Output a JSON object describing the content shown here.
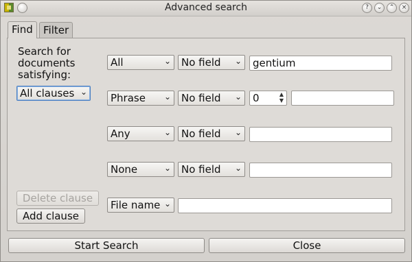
{
  "window": {
    "title": "Advanced search",
    "title_buttons": [
      "?",
      "⌄",
      "⌃",
      "×"
    ]
  },
  "tabs": [
    {
      "label": "Find",
      "active": true
    },
    {
      "label": "Filter",
      "active": false
    }
  ],
  "find": {
    "description": [
      "Search for",
      "documents",
      "satisfying:"
    ],
    "conjunction_select": "All clauses",
    "clauses": [
      {
        "type": "All",
        "field": "No field",
        "value": "gentium"
      },
      {
        "type": "Phrase",
        "field": "No field",
        "proximity": "0",
        "value": ""
      },
      {
        "type": "Any",
        "field": "No field",
        "value": ""
      },
      {
        "type": "None",
        "field": "No field",
        "value": ""
      },
      {
        "type": "File name",
        "value": ""
      }
    ],
    "delete_clause_label": "Delete clause",
    "add_clause_label": "Add clause"
  },
  "footer": {
    "start_search_label": "Start Search",
    "close_label": "Close"
  },
  "icons": {
    "dropdown": "chevron-down-icon",
    "spin_up": "▲",
    "spin_down": "▼",
    "chevron": "⌄"
  }
}
